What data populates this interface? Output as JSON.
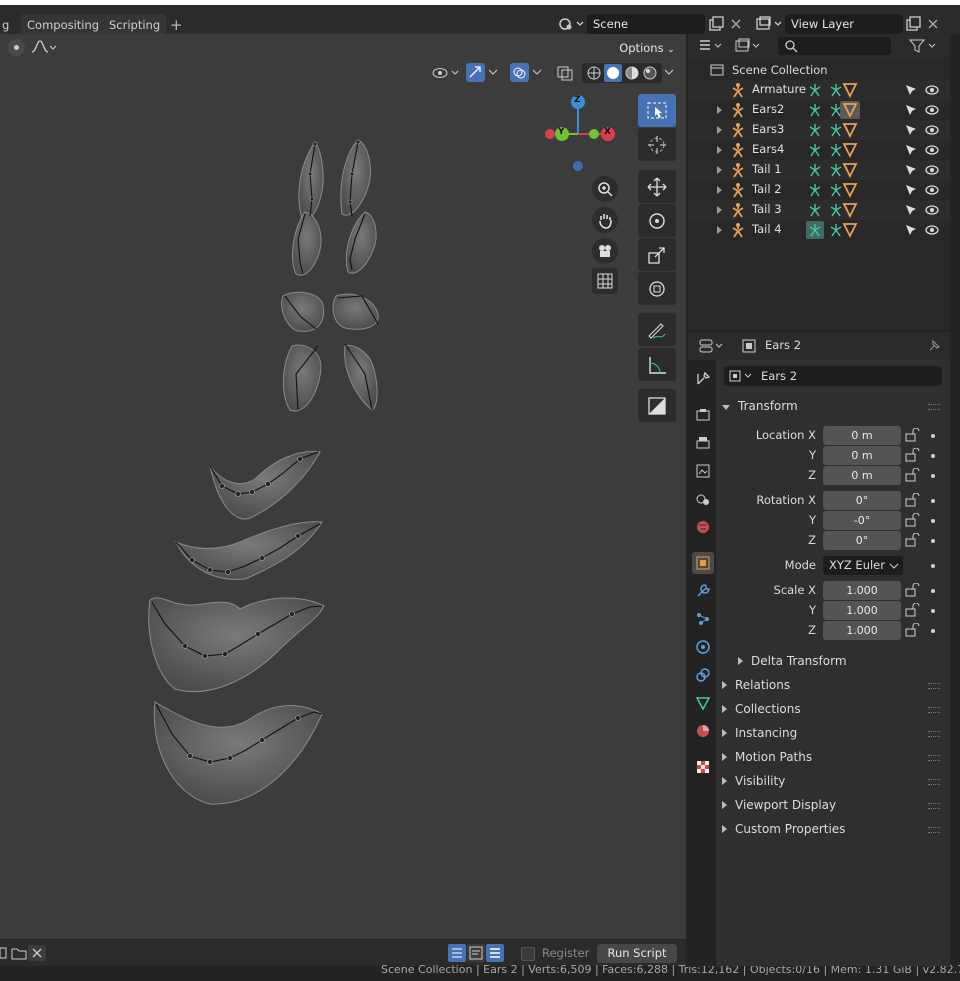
{
  "topbar": {
    "tab_cut": "g",
    "tabs": [
      "Compositing",
      "Scripting"
    ],
    "add_tab": "+",
    "scene_label": "Scene",
    "view_layer_label": "View Layer"
  },
  "viewport": {
    "options_label": "Options"
  },
  "text_editor": {
    "register_label": "Register",
    "run_script_label": "Run Script"
  },
  "status_bar": {
    "text": "Scene Collection | Ears 2 | Verts:6,509 | Faces:6,288 | Tris:12,162 | Objects:0/16 | Mem: 1.31 GiB | v2.82.7"
  },
  "outliner": {
    "root": "Scene Collection",
    "items": [
      {
        "label": "Armature"
      },
      {
        "label": "Ears2"
      },
      {
        "label": "Ears3"
      },
      {
        "label": "Ears4"
      },
      {
        "label": "Tail 1"
      },
      {
        "label": "Tail 2"
      },
      {
        "label": "Tail 3"
      },
      {
        "label": "Tail 4"
      }
    ]
  },
  "properties": {
    "header_object": "Ears 2",
    "object_name": "Ears 2",
    "transform_title": "Transform",
    "location": {
      "label_x": "Location X",
      "label_y": "Y",
      "label_z": "Z",
      "x": "0 m",
      "y": "0 m",
      "z": "0 m"
    },
    "rotation": {
      "label_x": "Rotation X",
      "label_y": "Y",
      "label_z": "Z",
      "x": "0°",
      "y": "-0°",
      "z": "0°"
    },
    "mode_label": "Mode",
    "mode_value": "XYZ Euler",
    "scale": {
      "label_x": "Scale X",
      "label_y": "Y",
      "label_z": "Z",
      "x": "1.000",
      "y": "1.000",
      "z": "1.000"
    },
    "delta_transform": "Delta Transform",
    "panels": [
      "Relations",
      "Collections",
      "Instancing",
      "Motion Paths",
      "Visibility",
      "Viewport Display",
      "Custom Properties"
    ]
  },
  "gizmo": {
    "z": "Z",
    "y": "Y",
    "x": "X"
  },
  "colors": {
    "accent": "#4772b3",
    "armature": "#e8a05a",
    "bone_green": "#46c8a0",
    "gizmo_x": "#d9404f",
    "gizmo_y": "#73c034",
    "gizmo_z": "#3b8ed8"
  }
}
